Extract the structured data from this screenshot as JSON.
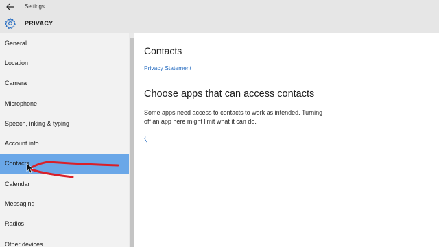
{
  "window": {
    "title": "Settings"
  },
  "header": {
    "title": "PRIVACY"
  },
  "sidebar": {
    "items": [
      {
        "label": "General"
      },
      {
        "label": "Location"
      },
      {
        "label": "Camera"
      },
      {
        "label": "Microphone"
      },
      {
        "label": "Speech, inking & typing"
      },
      {
        "label": "Account info"
      },
      {
        "label": "Contacts",
        "selected": true
      },
      {
        "label": "Calendar"
      },
      {
        "label": "Messaging"
      },
      {
        "label": "Radios"
      },
      {
        "label": "Other devices"
      }
    ]
  },
  "main": {
    "title": "Contacts",
    "privacy_link": "Privacy Statement",
    "section_heading": "Choose apps that can access contacts",
    "description": "Some apps need access to contacts to work as intended. Turning off an app here might limit what it can do."
  },
  "colors": {
    "accent": "#2a6fc2",
    "selected_bg": "#6aa7e8",
    "annotation": "#d9202a"
  },
  "icons": {
    "back": "arrow-left-icon",
    "settings": "gear-icon"
  }
}
